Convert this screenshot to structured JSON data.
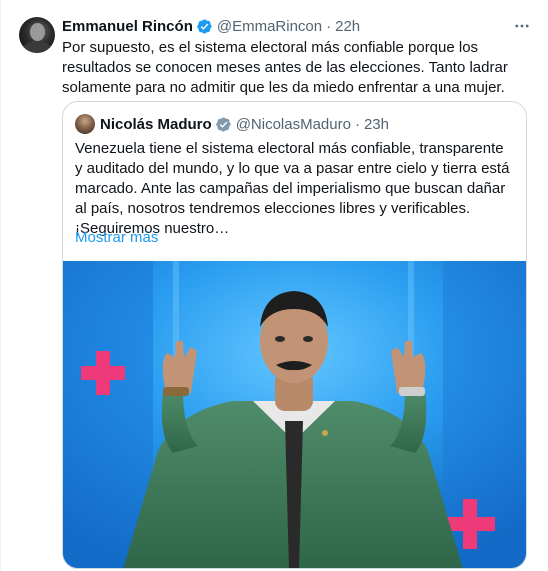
{
  "tweet": {
    "author_name": "Emmanuel Rincón",
    "handle": "@EmmaRincon",
    "separator": "·",
    "time": "22h",
    "more_glyph": "···",
    "text": "Por supuesto, es el sistema electoral más confiable porque los resultados se conocen meses antes de las elecciones. Tanto ladrar solamente para no admitir que les da miedo enfrentar a una mujer."
  },
  "quoted_tweet": {
    "author_name": "Nicolás Maduro",
    "handle": "@NicolasMaduro",
    "separator": "·",
    "time": "23h",
    "text": "Venezuela tiene el sistema electoral más confiable, transparente y auditado del mundo, y lo que va a pasar entre cielo y tierra está marcado. Ante las campañas del imperialismo que buscan dañar al país, nosotros tendremos elecciones libres y verificables. ¡Seguiremos nuestro…",
    "show_more": "Mostrar más"
  },
  "colors": {
    "accent": "#1d9bf0",
    "verified_badge": "#1d9bf0",
    "image_background": "#1f8fe0",
    "cross_pink": "#ee3a78",
    "jacket_green": "#3e7a5a"
  },
  "icons": {
    "verified": "verified-badge-icon",
    "more": "more-options-icon"
  }
}
